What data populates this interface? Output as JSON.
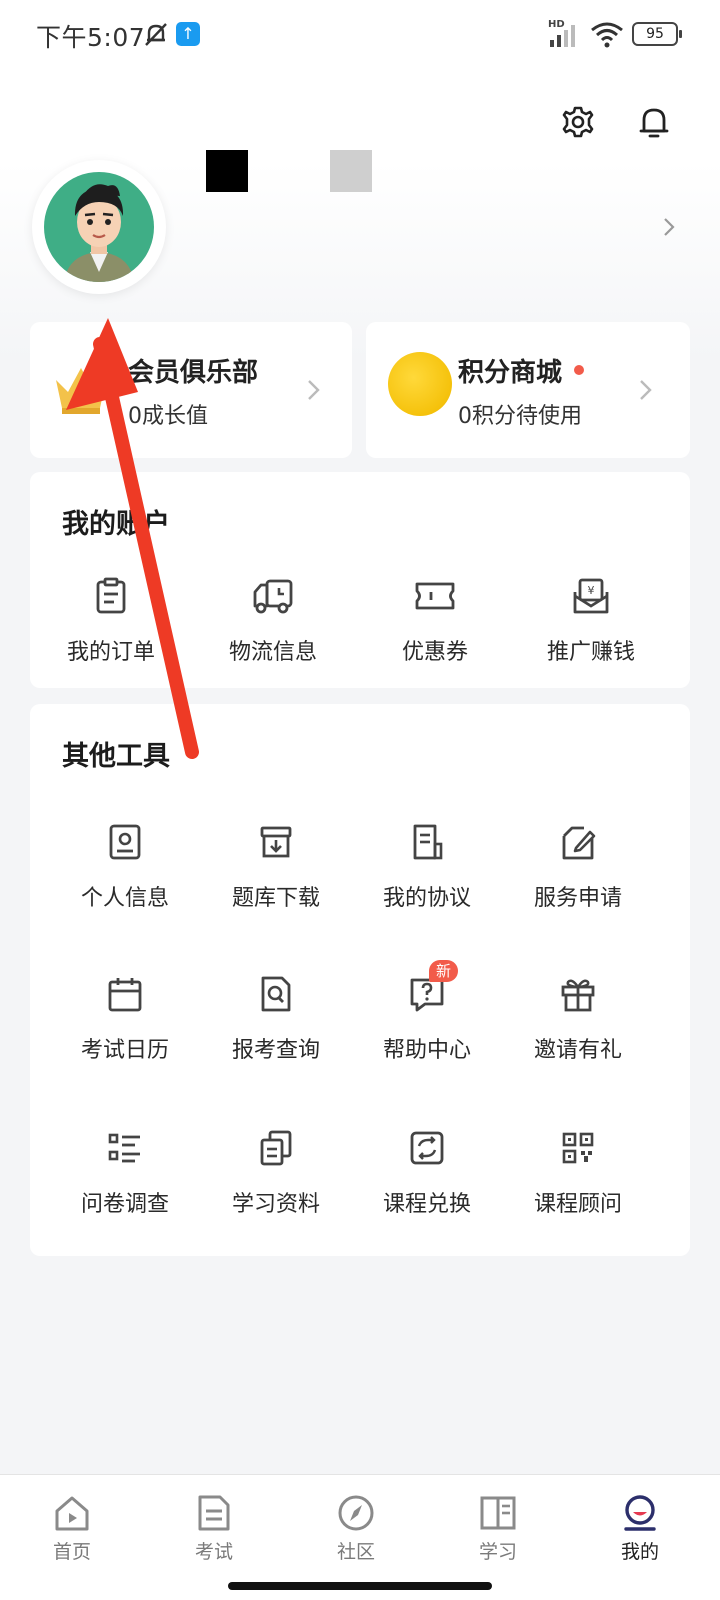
{
  "status_bar": {
    "time": "下午5:07",
    "network": "HD",
    "battery": "95"
  },
  "header": {
    "settings_icon": "gear-icon",
    "notification_icon": "bell-icon"
  },
  "profile": {
    "avatar_icon": "avatar-cartoon-man"
  },
  "member_club": {
    "title": "会员俱乐部",
    "subtitle": "0成长值"
  },
  "points_mall": {
    "title": "积分商城",
    "subtitle": "0积分待使用"
  },
  "my_account": {
    "title": "我的账户",
    "items": [
      {
        "label": "我的订单",
        "icon": "order-clipboard-icon"
      },
      {
        "label": "物流信息",
        "icon": "delivery-truck-icon"
      },
      {
        "label": "优惠券",
        "icon": "coupon-ticket-icon"
      },
      {
        "label": "推广赚钱",
        "icon": "money-envelope-icon"
      }
    ]
  },
  "other_tools": {
    "title": "其他工具",
    "items": [
      {
        "label": "个人信息",
        "icon": "id-card-icon"
      },
      {
        "label": "题库下载",
        "icon": "download-box-icon"
      },
      {
        "label": "我的协议",
        "icon": "agreement-doc-icon"
      },
      {
        "label": "服务申请",
        "icon": "edit-form-icon"
      },
      {
        "label": "考试日历",
        "icon": "calendar-icon"
      },
      {
        "label": "报考查询",
        "icon": "search-doc-icon"
      },
      {
        "label": "帮助中心",
        "icon": "help-chat-icon",
        "badge": "新"
      },
      {
        "label": "邀请有礼",
        "icon": "gift-icon"
      },
      {
        "label": "问卷调查",
        "icon": "list-icon"
      },
      {
        "label": "学习资料",
        "icon": "documents-icon"
      },
      {
        "label": "课程兑换",
        "icon": "exchange-icon"
      },
      {
        "label": "课程顾问",
        "icon": "qr-code-icon"
      }
    ]
  },
  "tabbar": {
    "tabs": [
      {
        "label": "首页",
        "icon": "home-icon"
      },
      {
        "label": "考试",
        "icon": "exam-doc-icon"
      },
      {
        "label": "社区",
        "icon": "compass-icon"
      },
      {
        "label": "学习",
        "icon": "book-icon"
      },
      {
        "label": "我的",
        "icon": "profile-face-icon",
        "active": true
      }
    ]
  },
  "colors": {
    "accent_red": "#f25b4a",
    "coin_yellow": "#f5c20c",
    "avatar_green": "#3fae86",
    "arrow_red": "#ee3a25",
    "icon_gray": "#4a4a4a"
  }
}
